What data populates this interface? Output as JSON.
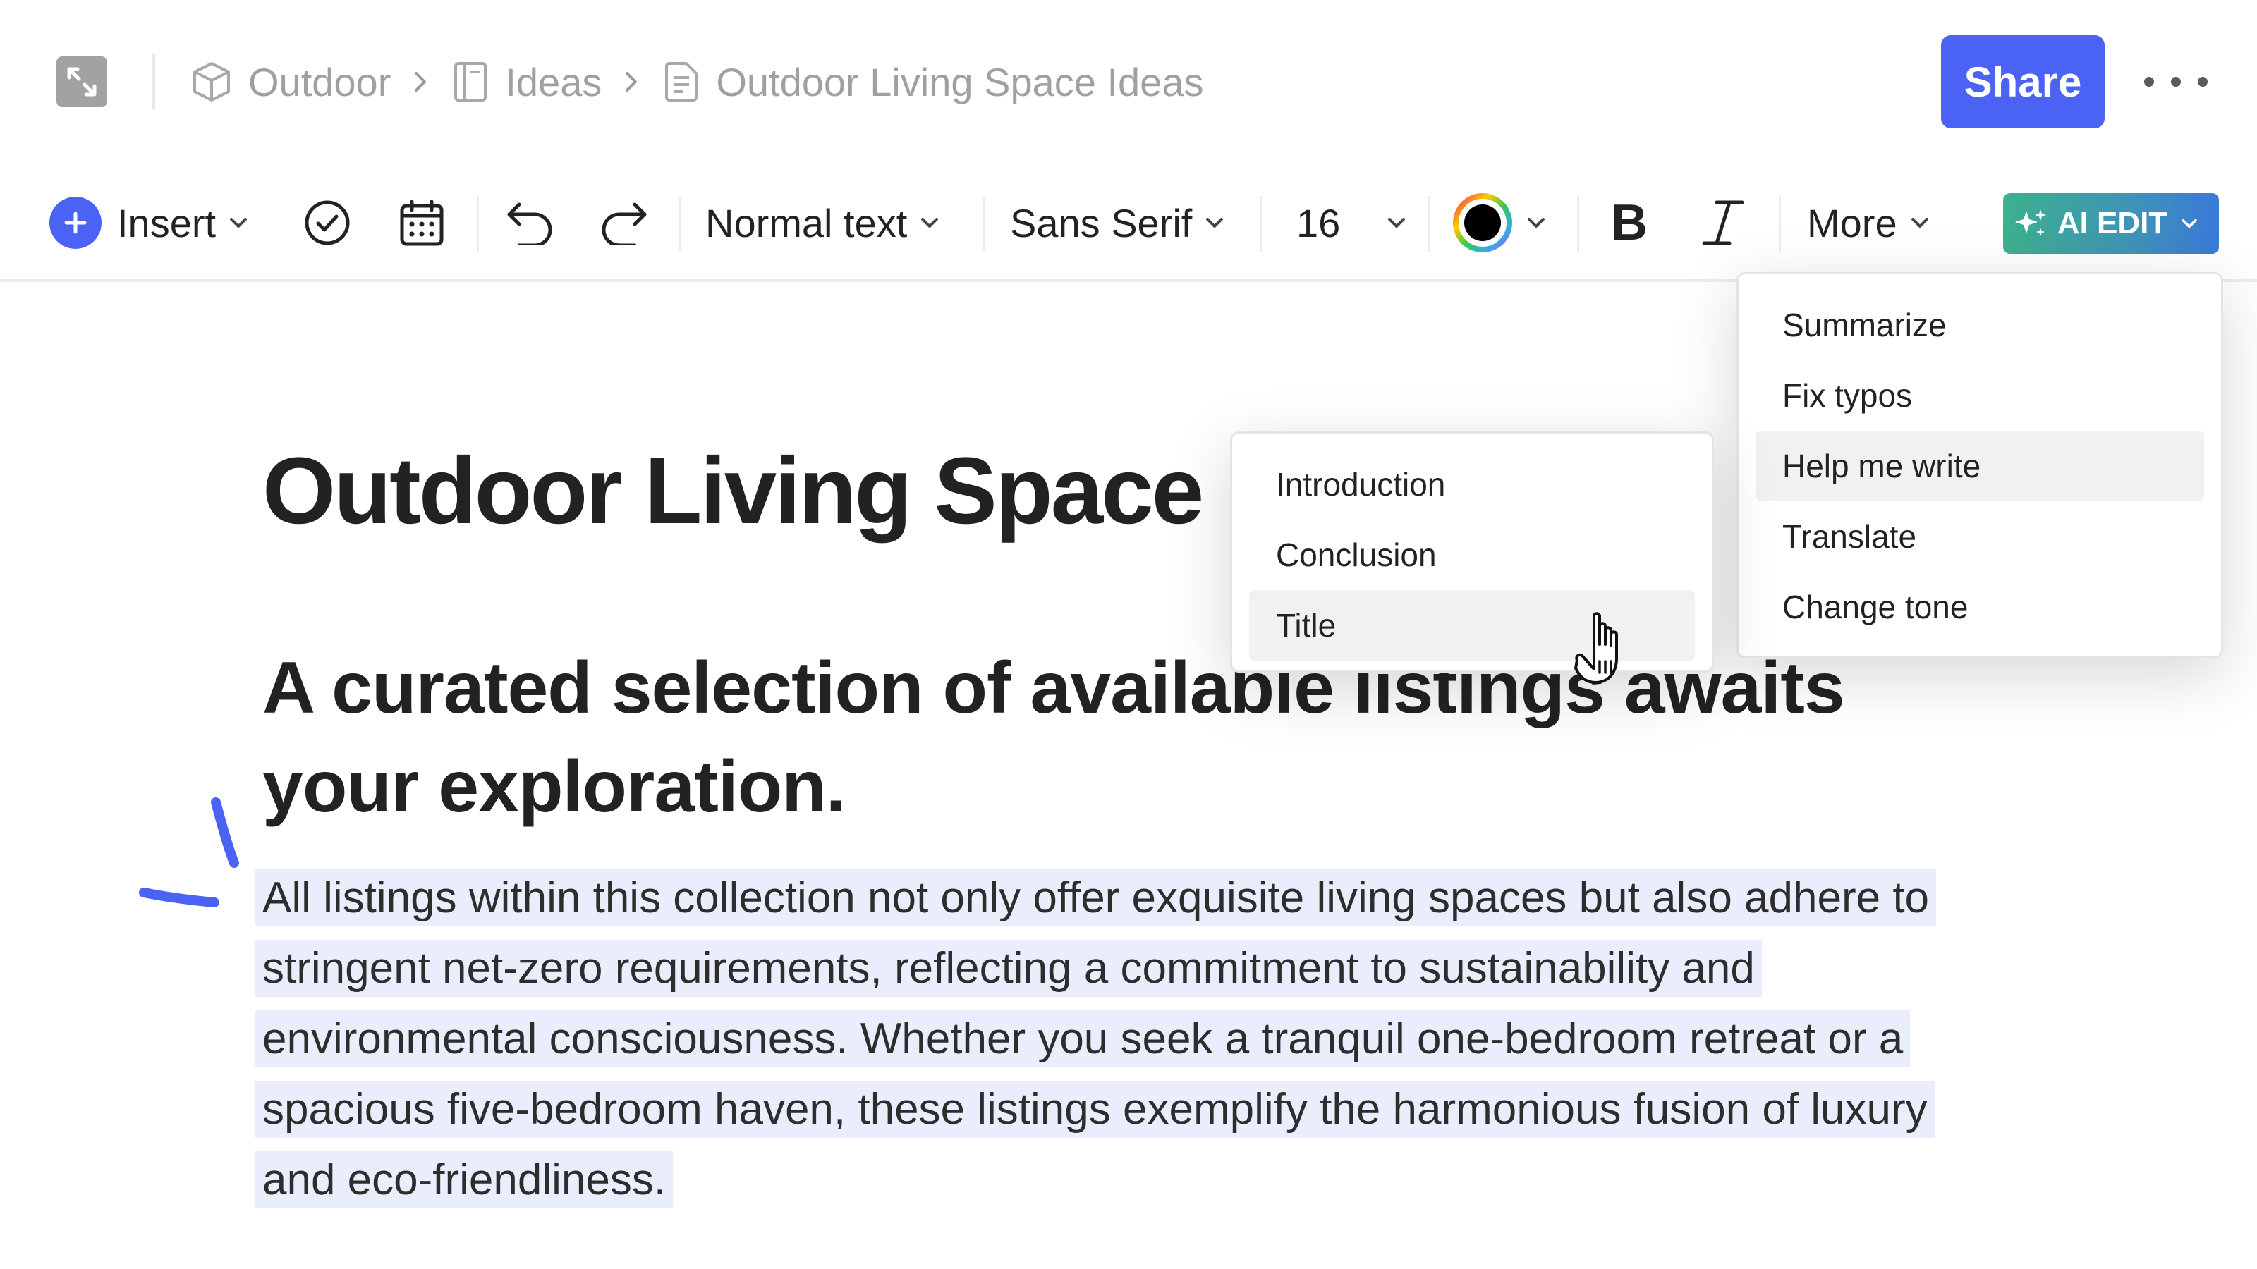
{
  "breadcrumb": {
    "items": [
      {
        "label": "Outdoor",
        "icon": "cube-icon"
      },
      {
        "label": "Ideas",
        "icon": "notebook-icon"
      },
      {
        "label": "Outdoor Living Space Ideas",
        "icon": "document-icon"
      }
    ]
  },
  "header": {
    "share_label": "Share"
  },
  "toolbar": {
    "insert_label": "Insert",
    "text_style": "Normal text",
    "font": "Sans Serif",
    "font_size": "16",
    "text_color": "#000000",
    "bold_label": "B",
    "more_label": "More",
    "ai_edit_label": "AI EDIT"
  },
  "document": {
    "title": "Outdoor Living Space Ideas",
    "subtitle": "A curated selection of available listings awaits your exploration.",
    "body": "All listings within this collection not only offer exquisite living spaces but also adhere to stringent net-zero requirements, reflecting a commitment to sustainability and environmental consciousness. Whether you seek a tranquil one-bedroom retreat or a spacious five-bedroom haven, these listings exemplify the harmonious fusion of luxury and eco-friendliness."
  },
  "ai_menu": {
    "items": [
      "Summarize",
      "Fix typos",
      "Help me write",
      "Translate",
      "Change tone"
    ],
    "active": "Help me write"
  },
  "write_submenu": {
    "items": [
      "Introduction",
      "Conclusion",
      "Title"
    ],
    "hovered": "Title"
  },
  "colors": {
    "accent": "#4a63f4",
    "selection": "#eaeefc",
    "ai_gradient_start": "#3db08d",
    "ai_gradient_end": "#3a79d8"
  }
}
